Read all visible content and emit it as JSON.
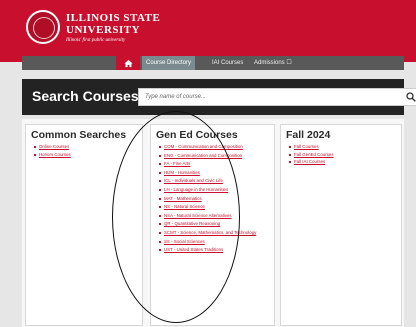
{
  "header": {
    "name_line1": "ILLINOIS STATE",
    "name_line2": "UNIVERSITY",
    "tagline": "Illinois' first public university",
    "brand_color": "#c8102e"
  },
  "nav": {
    "home_icon": "home-icon",
    "items": [
      {
        "label": "Course Directory",
        "active": true
      },
      {
        "label": "IAI Courses",
        "active": false
      },
      {
        "label": "Admissions ☐",
        "active": false
      }
    ]
  },
  "search": {
    "title": "Search Courses",
    "placeholder": "Type name of course..."
  },
  "common": {
    "title": "Common Searches",
    "links": [
      "Online Courses",
      "Honors Courses"
    ]
  },
  "gened": {
    "title": "Gen Ed Courses",
    "links": [
      "COM - Communication and Composition",
      "ENG - Communication and Composition",
      "FA - Fine Arts",
      "HUM - Humanities",
      "ICL - Individuals and Civic Life",
      "LH - Language in the Humanities",
      "MAT - Mathematics",
      "NS - Natural Science",
      "NSA - Natural Science Alternatives",
      "QR - Quantitative Reasoning",
      "SCMT - Science, Mathematics, and Technology",
      "SS - Social Sciences",
      "UST - United States Traditions"
    ]
  },
  "fall": {
    "title": "Fall 2024",
    "links": [
      "Fall Courses",
      "Fall GenEd Courses",
      "Fall IAI Courses"
    ]
  }
}
